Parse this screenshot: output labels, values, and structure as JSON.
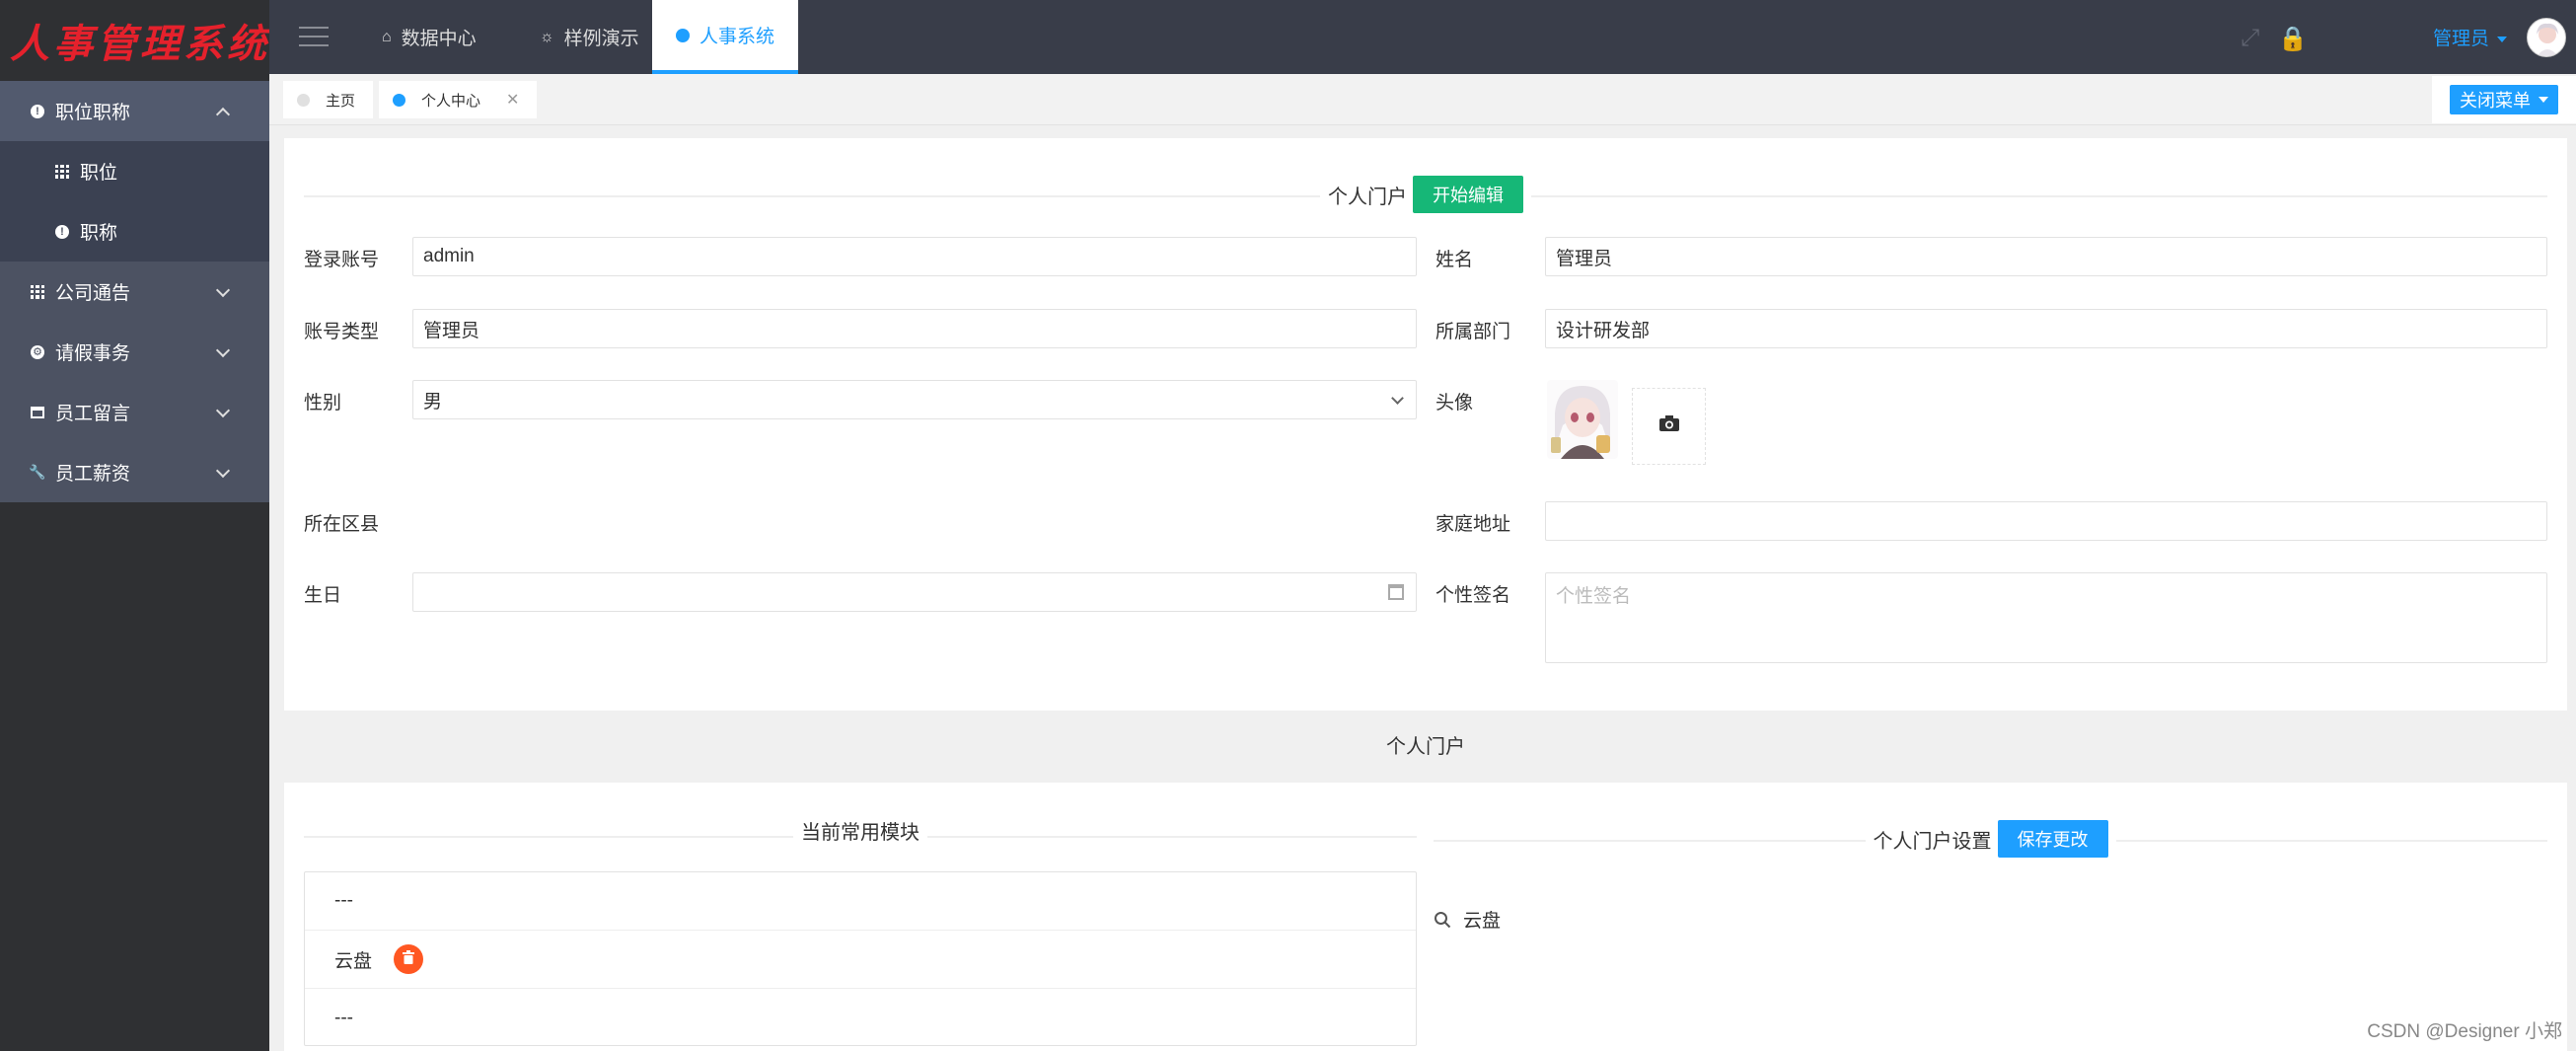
{
  "app": {
    "logo_text": "人事管理系统"
  },
  "sidebar": {
    "items": [
      {
        "label": "职位职称",
        "icon": "info-circle-icon",
        "state": "expanded"
      },
      {
        "label": "职位",
        "icon": "grid-icon",
        "sub": true
      },
      {
        "label": "职称",
        "icon": "info-circle-icon",
        "sub": true
      },
      {
        "label": "公司通告",
        "icon": "grid-icon",
        "state": "collapsed"
      },
      {
        "label": "请假事务",
        "icon": "gear-icon",
        "state": "collapsed"
      },
      {
        "label": "员工留言",
        "icon": "calendar-icon",
        "state": "collapsed"
      },
      {
        "label": "员工薪资",
        "icon": "wrench-icon",
        "state": "collapsed"
      }
    ]
  },
  "header": {
    "tabs": [
      {
        "label": "数据中心",
        "icon": "home-icon"
      },
      {
        "label": "样例演示",
        "icon": "bulb-icon"
      },
      {
        "label": "人事系统",
        "icon": "info-circle-icon",
        "active": true
      }
    ],
    "user_name": "管理员"
  },
  "tabbar": {
    "tabs": [
      {
        "label": "主页"
      },
      {
        "label": "个人中心",
        "active": true
      }
    ],
    "close_menu_label": "关闭菜单"
  },
  "profile": {
    "title": "个人门户",
    "edit_button": "开始编辑",
    "fields": {
      "login_account": {
        "label": "登录账号",
        "value": "admin"
      },
      "name": {
        "label": "姓名",
        "value": "管理员"
      },
      "account_type": {
        "label": "账号类型",
        "value": "管理员"
      },
      "department": {
        "label": "所属部门",
        "value": "设计研发部"
      },
      "gender": {
        "label": "性别",
        "value": "男"
      },
      "avatar": {
        "label": "头像"
      },
      "district": {
        "label": "所在区县"
      },
      "home_address": {
        "label": "家庭地址",
        "value": ""
      },
      "birthday": {
        "label": "生日",
        "value": ""
      },
      "signature": {
        "label": "个性签名",
        "placeholder": "个性签名"
      }
    }
  },
  "portal": {
    "section_title": "个人门户",
    "modules_title": "当前常用模块",
    "modules": [
      "---",
      "云盘",
      "---"
    ],
    "settings_title": "个人门户设置",
    "save_button": "保存更改",
    "search_item": "云盘"
  },
  "watermark": "CSDN @Designer 小郑",
  "colors": {
    "accent": "#1e9fff",
    "success": "#16b777",
    "danger": "#ff5722",
    "sidebar": "#2f3033",
    "header": "#393d49"
  }
}
